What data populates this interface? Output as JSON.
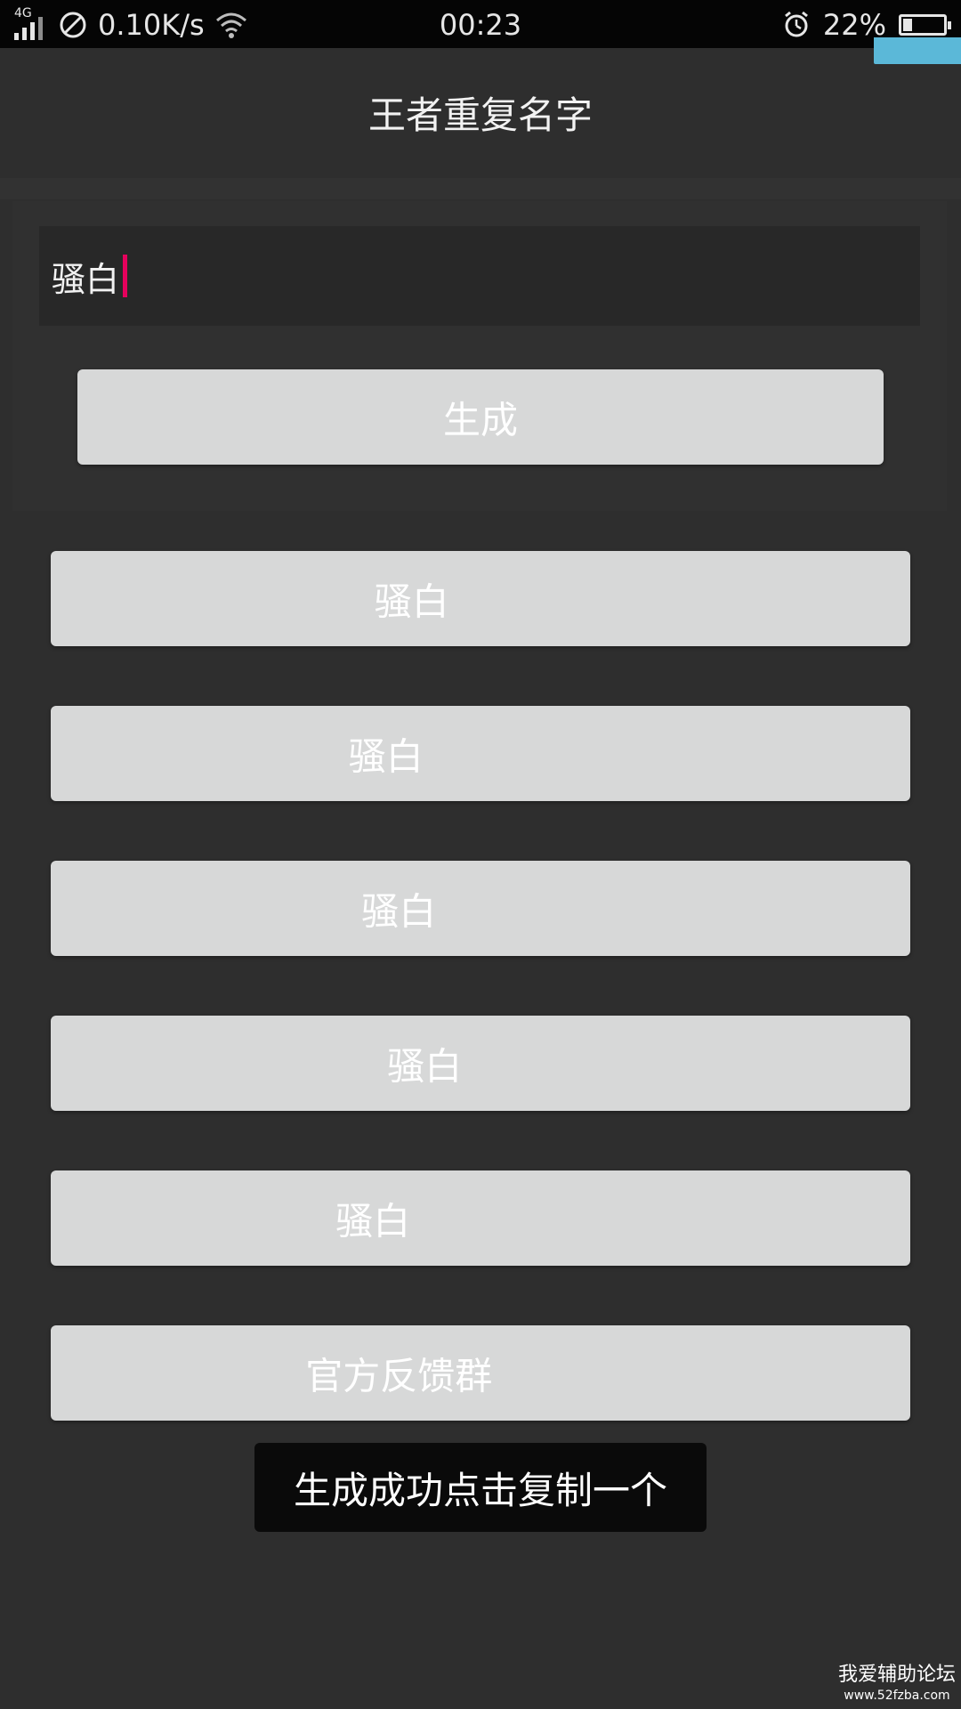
{
  "status_bar": {
    "network_type": "4G",
    "speed": "0.10K/s",
    "time": "00:23",
    "battery_percent": "22%",
    "battery_level": 0.22,
    "icons": [
      "signal-icon",
      "no-disturb-icon",
      "wifi-icon",
      "alarm-icon",
      "battery-icon"
    ]
  },
  "app": {
    "title": "王者重复名字"
  },
  "input": {
    "value": "骚白"
  },
  "generate_button": {
    "label": "生成"
  },
  "results": [
    {
      "label": "骚白"
    },
    {
      "label": "骚白"
    },
    {
      "label": "骚白"
    },
    {
      "label": "骚白"
    },
    {
      "label": "骚白"
    }
  ],
  "feedback_button": {
    "label": "官方反馈群"
  },
  "toast": {
    "message": "生成成功点击复制一个"
  },
  "watermark": {
    "line1": "我爱辅助论坛",
    "line2": "www.52fzba.com"
  },
  "colors": {
    "background": "#2e2e2e",
    "button": "#d7d8d8",
    "cursor": "#e6005c",
    "corner_tag": "#5bb8d8"
  }
}
